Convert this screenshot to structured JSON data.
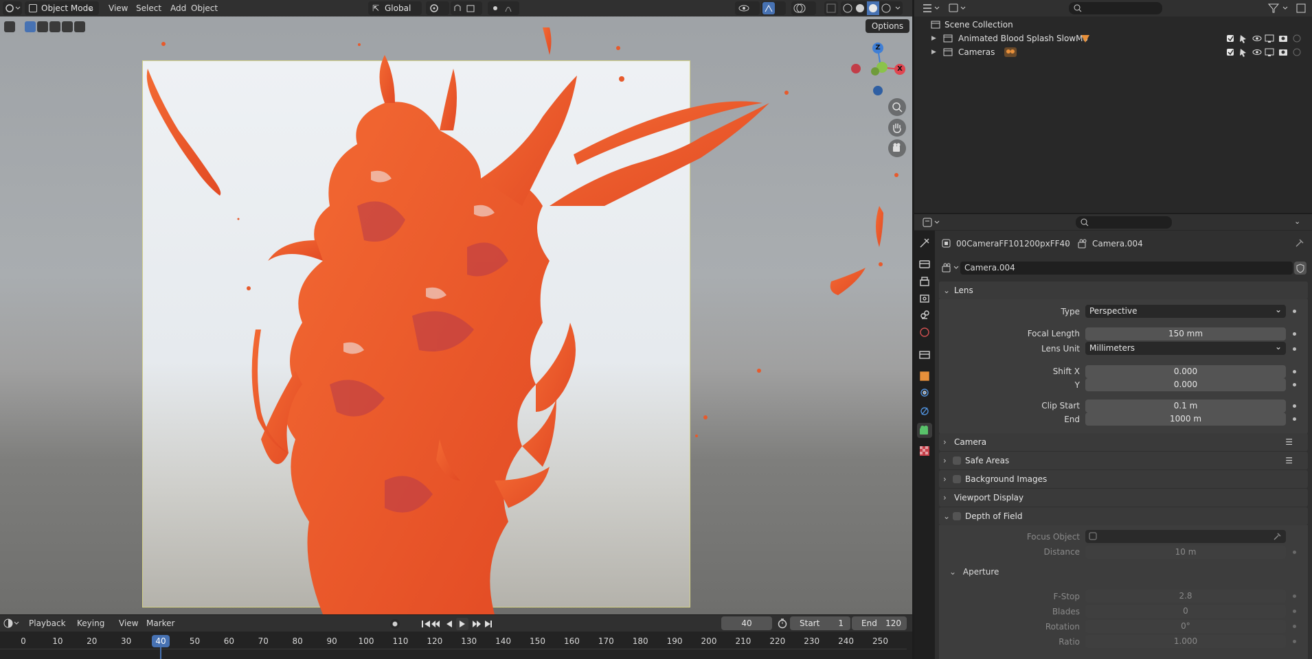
{
  "viewport": {
    "mode": "Object Mode",
    "menus": [
      "View",
      "Select",
      "Add",
      "Object"
    ],
    "transform_orientation": "Global",
    "options_label": "Options",
    "gizmo": {
      "z": "Z",
      "y": "Y",
      "x": "X"
    }
  },
  "timeline": {
    "menus": [
      "Playback",
      "Keying",
      "View",
      "Marker"
    ],
    "current_frame": "40",
    "start_label": "Start",
    "start_value": "1",
    "end_label": "End",
    "end_value": "120",
    "ruler": [
      "0",
      "10",
      "20",
      "30",
      "40",
      "50",
      "60",
      "70",
      "80",
      "90",
      "100",
      "110",
      "120",
      "130",
      "140",
      "150",
      "160",
      "170",
      "180",
      "190",
      "200",
      "210",
      "220",
      "230",
      "240",
      "250"
    ]
  },
  "outliner": {
    "root": "Scene Collection",
    "items": [
      {
        "label": "Animated Blood Splash SlowMo"
      },
      {
        "label": "Cameras"
      }
    ]
  },
  "properties": {
    "breadcrumb_object": "00CameraFF101200pxFF40",
    "breadcrumb_data": "Camera.004",
    "datablock_name": "Camera.004",
    "lens": {
      "title": "Lens",
      "type_label": "Type",
      "type_value": "Perspective",
      "focal_label": "Focal Length",
      "focal_value": "150 mm",
      "unit_label": "Lens Unit",
      "unit_value": "Millimeters",
      "shiftx_label": "Shift X",
      "shiftx_value": "0.000",
      "shifty_label": "Y",
      "shifty_value": "0.000",
      "clipstart_label": "Clip Start",
      "clipstart_value": "0.1 m",
      "clipend_label": "End",
      "clipend_value": "1000 m"
    },
    "panels": {
      "camera": "Camera",
      "safe_areas": "Safe Areas",
      "background_images": "Background Images",
      "viewport_display": "Viewport Display",
      "dof": "Depth of Field"
    },
    "dof": {
      "focus_label": "Focus Object",
      "distance_label": "Distance",
      "distance_value": "10 m",
      "aperture": "Aperture",
      "fstop_label": "F-Stop",
      "fstop_value": "2.8",
      "blades_label": "Blades",
      "blades_value": "0",
      "rotation_label": "Rotation",
      "rotation_value": "0°",
      "ratio_label": "Ratio",
      "ratio_value": "1.000"
    }
  },
  "colors": {
    "accent": "#4772b3",
    "splash": "#ee5a2a",
    "splash_dark": "#c43a2c",
    "axis_x": "#e0454f",
    "axis_y": "#8bc34a",
    "axis_z": "#3f7fd6"
  }
}
